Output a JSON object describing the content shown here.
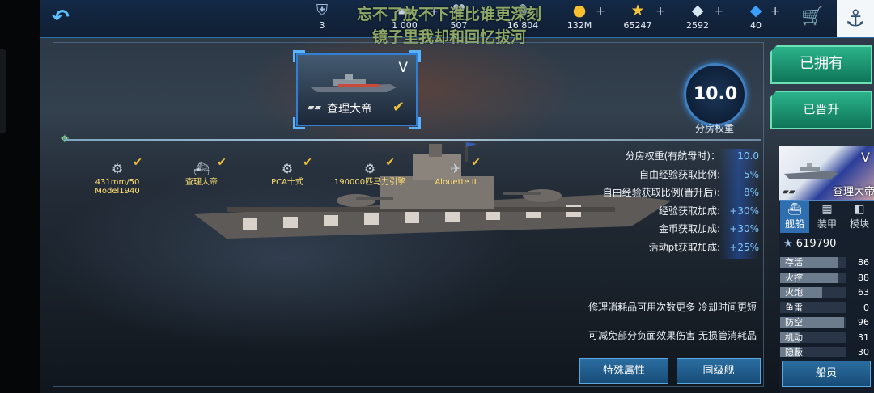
{
  "overlay_text": {
    "line1": "忘不了放不下谁比谁更深刻",
    "line2": "镜子里我却和回忆拔河"
  },
  "resources": [
    {
      "icon": "rank-badge-icon",
      "value": "3",
      "plus": ""
    },
    {
      "icon": "steel-icon",
      "value": "1 000",
      "plus": "+"
    },
    {
      "icon": "heart-icon",
      "value": "507",
      "plus": "+"
    },
    {
      "icon": "oil-icon",
      "value": "16 804",
      "plus": ""
    },
    {
      "icon": "gold-coin-icon",
      "value": "132M",
      "plus": "+"
    },
    {
      "icon": "star-icon",
      "value": "65247",
      "plus": "+"
    },
    {
      "icon": "diamond-icon",
      "value": "2592",
      "plus": "+"
    },
    {
      "icon": "blue-gem-icon",
      "value": "40",
      "plus": "+"
    }
  ],
  "ship_card": {
    "tier": "V",
    "name": "查理大帝",
    "mark": "▰▰"
  },
  "weight": {
    "value": "10.0",
    "label": "分房权重"
  },
  "equipment": [
    {
      "name": "431mm/50 Model1940",
      "icon": "main-gun-icon"
    },
    {
      "name": "查理大帝",
      "icon": "ship-hull-icon"
    },
    {
      "name": "PCA十式",
      "icon": "aa-gun-icon"
    },
    {
      "name": "190000匹马力引擎",
      "icon": "engine-icon"
    },
    {
      "name": "Alouette II",
      "icon": "helicopter-icon"
    }
  ],
  "stats": [
    {
      "label": "分房权重(有航母时)：",
      "value": "10.0"
    },
    {
      "label": "自由经验获取比例:",
      "value": "5%"
    },
    {
      "label": "自由经验获取比例(晋升后):",
      "value": "8%"
    },
    {
      "label": "经验获取加成:",
      "value": "+30%"
    },
    {
      "label": "金币获取加成:",
      "value": "+30%"
    },
    {
      "label": "活动pt获取加成:",
      "value": "+25%"
    }
  ],
  "descriptions": [
    "修理消耗品可用次数更多 冷却时间更短",
    "可减免部分负面效果伤害 无损管消耗品"
  ],
  "buttons": {
    "special": "特殊属性",
    "same_class": "同级舰",
    "owned": "已拥有",
    "promoted": "已晋升",
    "crew": "船员"
  },
  "right_card": {
    "tier": "V",
    "name": "查理大帝",
    "mark": "▰▰"
  },
  "tabs": [
    {
      "label": "舰船",
      "icon": "ship-tab-icon"
    },
    {
      "label": "装甲",
      "icon": "armor-tab-icon"
    },
    {
      "label": "模块",
      "icon": "module-tab-icon"
    }
  ],
  "score": {
    "value": "619790"
  },
  "attributes": [
    {
      "label": "存活",
      "value": 86
    },
    {
      "label": "火控",
      "value": 88
    },
    {
      "label": "火炮",
      "value": 63
    },
    {
      "label": "鱼雷",
      "value": 0
    },
    {
      "label": "防空",
      "value": 96
    },
    {
      "label": "机动",
      "value": 31
    },
    {
      "label": "隐蔽",
      "value": 30
    }
  ],
  "colors": {
    "accent": "#2f7fd6",
    "stat_value": "#7fc6ff",
    "equip_text": "#ffe070",
    "check": "#f5c33a",
    "owned_button": "#1a9a72"
  }
}
